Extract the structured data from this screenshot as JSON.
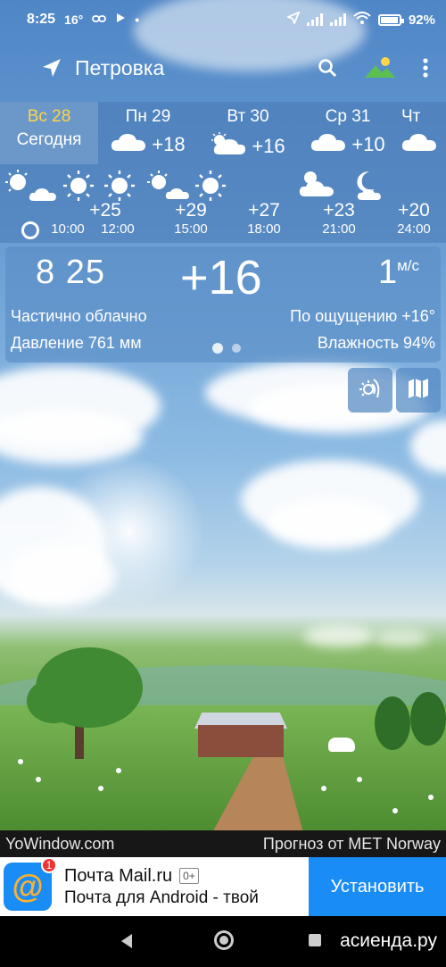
{
  "status_bar": {
    "time": "8:25",
    "temp": "16°",
    "battery": "92%",
    "icons": [
      "link-icon",
      "play-icon",
      "location-icon",
      "signal-icon",
      "wifi-icon",
      "battery-icon"
    ]
  },
  "app_bar": {
    "city": "Петровка",
    "icons": [
      "location-arrow-icon",
      "search-icon",
      "landscape-icon",
      "more-vert-icon"
    ]
  },
  "days": [
    {
      "name": "Вс 28",
      "sub": "Сегодня",
      "temp": "",
      "icon": "",
      "active": true
    },
    {
      "name": "Пн 29",
      "temp": "+18",
      "icon": "cloud-icon"
    },
    {
      "name": "Вт 30",
      "temp": "+16",
      "icon": "partly-cloudy-icon"
    },
    {
      "name": "Ср 31",
      "temp": "+10",
      "icon": "cloud-icon"
    },
    {
      "name": "Чт",
      "temp": "",
      "icon": "cloud-icon"
    }
  ],
  "hourly": {
    "temps": [
      "+25",
      "+29",
      "+27",
      "+23",
      "+20"
    ],
    "times": [
      "10:00",
      "12:00",
      "15:00",
      "18:00",
      "21:00",
      "24:00"
    ],
    "icons": [
      "partly-cloudy-icon",
      "sun-icon",
      "sun-icon",
      "partly-cloudy-icon",
      "sun-icon",
      "cloud-icon",
      "moon-cloud-icon"
    ]
  },
  "current": {
    "time": "8 25",
    "temp": "+16",
    "wind_value": "1",
    "wind_unit": "м/с",
    "condition": "Частично облачно",
    "feels_like": "По ощущению +16°",
    "pressure": "Давление 761 мм",
    "humidity": "Влажность 94%",
    "page_count": 2,
    "page_active": 1
  },
  "side_buttons": [
    "weather-radar-icon",
    "map-icon"
  ],
  "credits": {
    "left": "YoWindow.com",
    "right": "Прогноз от MET Norway"
  },
  "ad": {
    "icon_badge": "1",
    "title": "Почта Mail.ru",
    "age": "0+",
    "subtitle": "Почта для Android - твой",
    "button": "Установить"
  },
  "nav": {
    "watermark": "асиенда.ру"
  },
  "colors": {
    "accent_today": "#ffd54a",
    "ad_button": "#1a8cf5"
  }
}
